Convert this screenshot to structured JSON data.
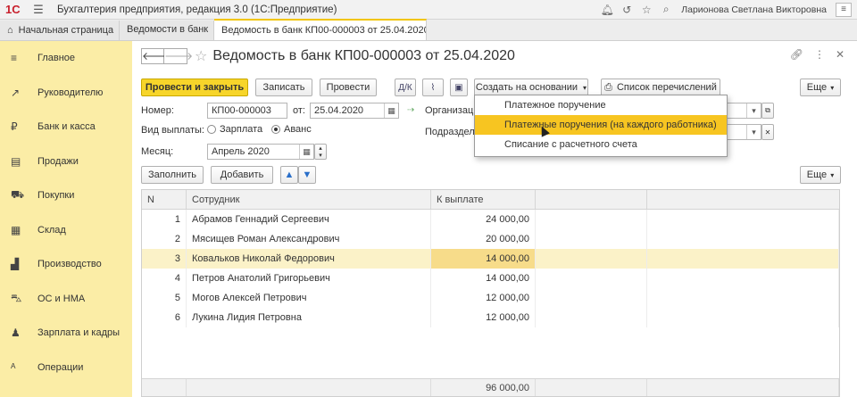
{
  "titlebar": {
    "logo": "1С",
    "title": "Бухгалтерия предприятия, редакция 3.0  (1С:Предприятие)",
    "user": "Ларионова Светлана Викторовна"
  },
  "tabs": {
    "home": "Начальная страница",
    "t1": "Ведомости в банк",
    "active": "Ведомость в банк КП00-000003 от 25.04.2020"
  },
  "sidebar": {
    "items": [
      {
        "label": "Главное",
        "icon": "≡"
      },
      {
        "label": "Руководителю",
        "icon": "↗"
      },
      {
        "label": "Банк и касса",
        "icon": "₽"
      },
      {
        "label": "Продажи",
        "icon": "▤"
      },
      {
        "label": "Покупки",
        "icon": "⛟"
      },
      {
        "label": "Склад",
        "icon": "▦"
      },
      {
        "label": "Производство",
        "icon": "▟"
      },
      {
        "label": "ОС и НМА",
        "icon": "⛍"
      },
      {
        "label": "Зарплата и кадры",
        "icon": "♟"
      },
      {
        "label": "Операции",
        "icon": "ᴬ"
      }
    ]
  },
  "form": {
    "title": "Ведомость в банк КП00-000003 от 25.04.2020",
    "buttons": {
      "post_close": "Провести и закрыть",
      "save": "Записать",
      "post": "Провести",
      "create_based": "Создать на основании",
      "list": "Список перечислений",
      "more1": "Еще",
      "fill": "Заполнить",
      "add": "Добавить",
      "more2": "Еще"
    },
    "number_label": "Номер:",
    "number_value": "КП00-000003",
    "from_label": "от:",
    "date_value": "25.04.2020",
    "org_label": "Организация:",
    "subdiv_label": "Подразделение:",
    "paytype_label": "Вид выплаты:",
    "radio_salary": "Зарплата",
    "radio_advance": "Аванс",
    "month_label": "Месяц:",
    "month_value": "Апрель 2020"
  },
  "table": {
    "headers": [
      "N",
      "Сотрудник",
      "К выплате"
    ],
    "rows": [
      {
        "n": "1",
        "name": "Абрамов Геннадий Сергеевич",
        "amount": "24 000,00"
      },
      {
        "n": "2",
        "name": "Мясищев Роман Александрович",
        "amount": "20 000,00"
      },
      {
        "n": "3",
        "name": "Ковальков Николай Федорович",
        "amount": "14 000,00"
      },
      {
        "n": "4",
        "name": "Петров Анатолий Григорьевич",
        "amount": "14 000,00"
      },
      {
        "n": "5",
        "name": "Могов Алексей Петрович",
        "amount": "12 000,00"
      },
      {
        "n": "6",
        "name": "Лукина Лидия Петровна",
        "amount": "12 000,00"
      }
    ],
    "total": "96 000,00"
  },
  "dropdown": {
    "items": [
      "Платежное поручение",
      "Платежные поручения (на каждого работника)",
      "Списание с расчетного счета"
    ]
  },
  "colors": {
    "accent": "#f7d52a",
    "sidebar": "#fbeda6",
    "highlight": "#f7c521"
  }
}
